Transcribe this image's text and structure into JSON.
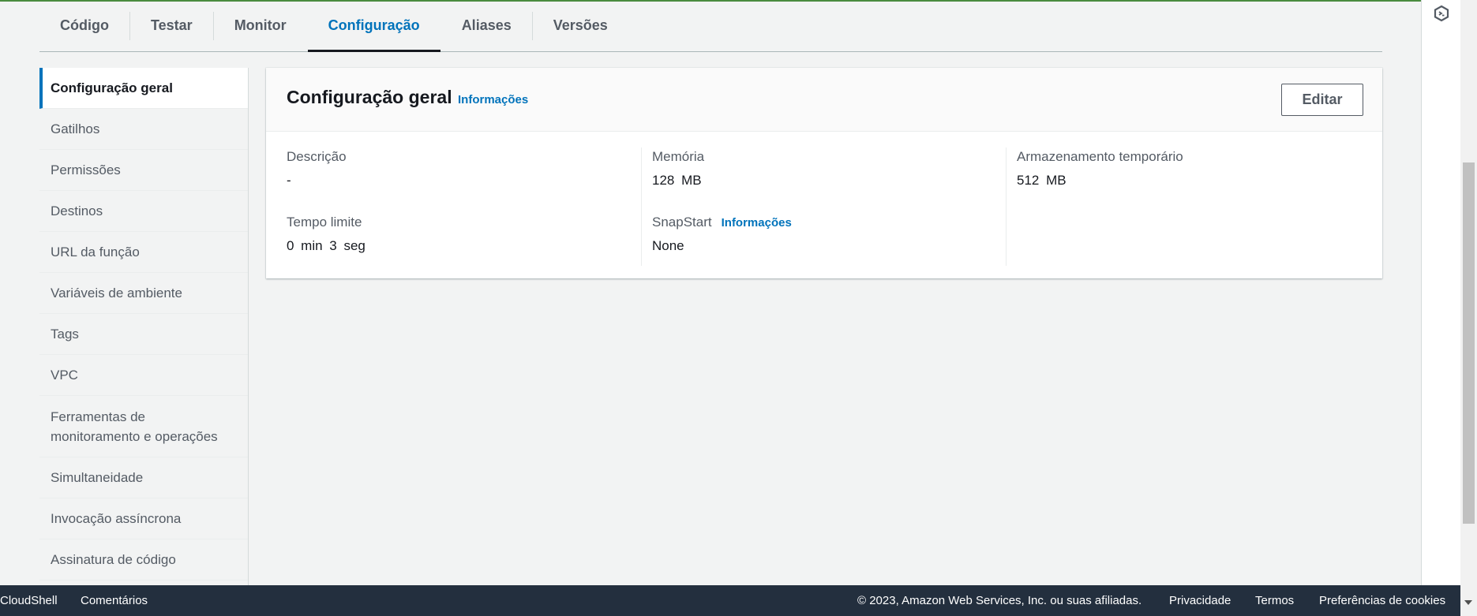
{
  "tabs": [
    {
      "label": "Código"
    },
    {
      "label": "Testar"
    },
    {
      "label": "Monitor"
    },
    {
      "label": "Configuração"
    },
    {
      "label": "Aliases"
    },
    {
      "label": "Versões"
    }
  ],
  "active_tab": "Configuração",
  "sidenav": {
    "items": [
      {
        "label": "Configuração geral"
      },
      {
        "label": "Gatilhos"
      },
      {
        "label": "Permissões"
      },
      {
        "label": "Destinos"
      },
      {
        "label": "URL da função"
      },
      {
        "label": "Variáveis de ambiente"
      },
      {
        "label": "Tags"
      },
      {
        "label": "VPC"
      },
      {
        "label": "Ferramentas de monitoramento e operações"
      },
      {
        "label": "Simultaneidade"
      },
      {
        "label": "Invocação assíncrona"
      },
      {
        "label": "Assinatura de código"
      }
    ],
    "active_item": "Configuração geral"
  },
  "panel": {
    "title": "Configuração geral",
    "info_link": "Informações",
    "edit_button": "Editar",
    "fields": {
      "description": {
        "label": "Descrição",
        "value": "-"
      },
      "timeout": {
        "label": "Tempo limite",
        "value": "0  min  3  seg"
      },
      "memory": {
        "label": "Memória",
        "value": "128  MB"
      },
      "snapstart": {
        "label": "SnapStart",
        "info_link": "Informações",
        "value": "None"
      },
      "ephemeral_storage": {
        "label": "Armazenamento temporário",
        "value": "512  MB"
      }
    }
  },
  "footer": {
    "cloudshell": "CloudShell",
    "feedback": "Comentários",
    "copyright": "© 2023, Amazon Web Services, Inc. ou suas afiliadas.",
    "privacy": "Privacidade",
    "terms": "Termos",
    "cookies": "Preferências de cookies"
  },
  "icons": {
    "right_panel": "cloudshell-hex-icon",
    "scroll_down": "scroll-down-arrow-icon"
  },
  "colors": {
    "accent": "#0073bb",
    "footer_bg": "#232f3e",
    "top_border": "#4a8c3f"
  }
}
